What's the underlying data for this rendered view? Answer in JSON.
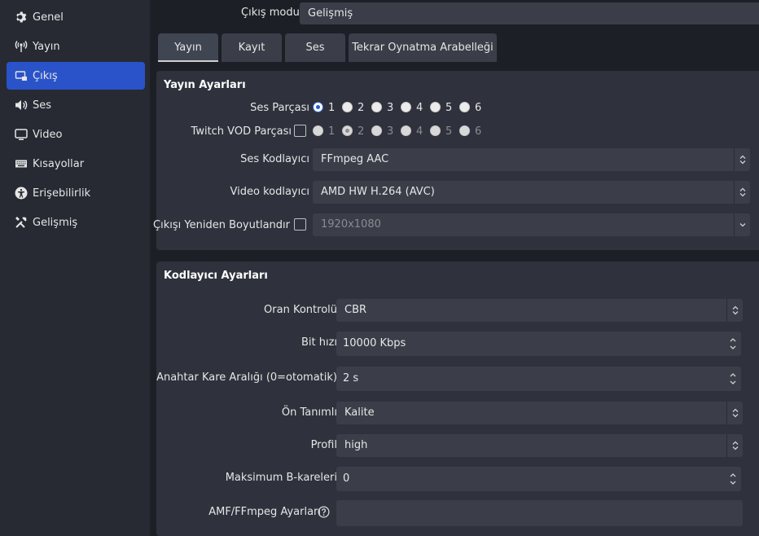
{
  "sidebar": {
    "items": [
      {
        "label": "Genel",
        "icon": "gear-icon"
      },
      {
        "label": "Yayın",
        "icon": "broadcast-icon"
      },
      {
        "label": "Çıkış",
        "icon": "output-icon"
      },
      {
        "label": "Ses",
        "icon": "speaker-icon"
      },
      {
        "label": "Video",
        "icon": "monitor-icon"
      },
      {
        "label": "Kısayollar",
        "icon": "keyboard-icon"
      },
      {
        "label": "Erişebilirlik",
        "icon": "accessibility-icon"
      },
      {
        "label": "Gelişmiş",
        "icon": "tools-icon"
      }
    ],
    "active": "Çıkış",
    "active_color": "#2a53c9"
  },
  "output_mode": {
    "label": "Çıkış modu",
    "value": "Gelişmiş"
  },
  "tabs": [
    {
      "label": "Yayın",
      "active": true
    },
    {
      "label": "Kayıt"
    },
    {
      "label": "Ses"
    },
    {
      "label": "Tekrar Oynatma Arabelleği"
    }
  ],
  "stream_settings": {
    "title": "Yayın Ayarları",
    "audio_track": {
      "label": "Ses Parçası",
      "options": [
        "1",
        "2",
        "3",
        "4",
        "5",
        "6"
      ],
      "selected": "1"
    },
    "twitch_vod": {
      "label": "Twitch VOD Parçası",
      "checked": false,
      "options": [
        "1",
        "2",
        "3",
        "4",
        "5",
        "6"
      ],
      "selected": "2"
    },
    "audio_encoder": {
      "label": "Ses Kodlayıcı",
      "value": "FFmpeg AAC"
    },
    "video_encoder": {
      "label": "Video kodlayıcı",
      "value": "AMD HW H.264 (AVC)"
    },
    "rescale": {
      "label": "Çıkışı Yeniden Boyutlandır",
      "checked": false,
      "value": "1920x1080"
    }
  },
  "encoder_settings": {
    "title": "Kodlayıcı Ayarları",
    "rate_control": {
      "label": "Oran Kontrolü",
      "value": "CBR"
    },
    "bitrate": {
      "label": "Bit hızı",
      "value": "10000 Kbps"
    },
    "keyframe": {
      "label": "Anahtar Kare Aralığı (0=otomatik)",
      "value": "2 s"
    },
    "preset": {
      "label": "Ön Tanımlı",
      "value": "Kalite"
    },
    "profile": {
      "label": "Profil",
      "value": "high"
    },
    "max_bframes": {
      "label": "Maksimum B-kareleri",
      "value": "0"
    },
    "amf_options": {
      "label": "AMF/FFmpeg Ayarları",
      "value": ""
    }
  }
}
